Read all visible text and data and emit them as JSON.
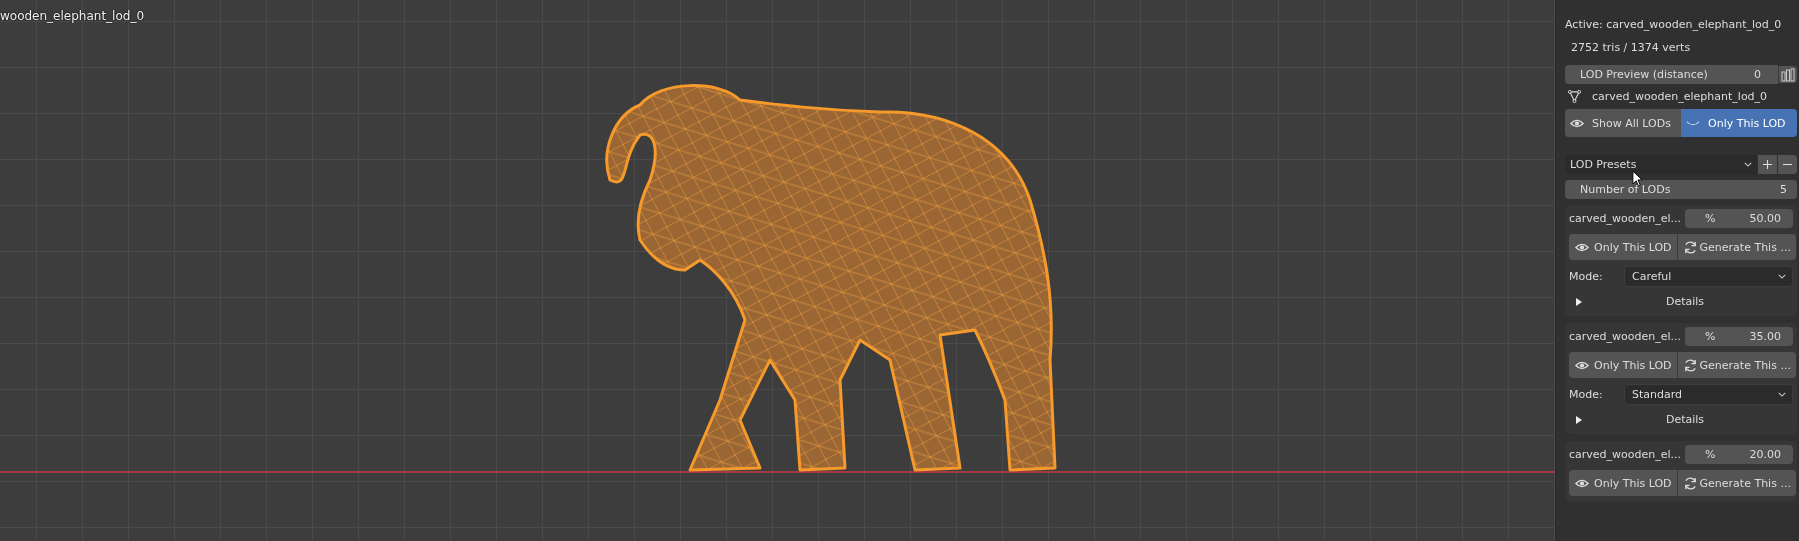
{
  "viewport": {
    "object_label": "wooden_elephant_lod_0"
  },
  "panel": {
    "active": "Active: carved_wooden_elephant_lod_0",
    "stats": "2752 tris / 1374 verts",
    "lod_preview": {
      "label": "LOD Preview (distance)",
      "value": "0"
    },
    "mesh_name": "carved_wooden_elephant_lod_0",
    "view_toggle": [
      {
        "label": "Show All LODs",
        "selected": false,
        "kind": "eye"
      },
      {
        "label": "Only This LOD",
        "selected": true,
        "kind": "closed-eye"
      }
    ],
    "presets": {
      "label": "LOD Presets"
    },
    "number_of_lods": {
      "label": "Number of LODs",
      "value": "5"
    },
    "lods": [
      {
        "name": "carved_wooden_el...",
        "unit": "%",
        "ratio": "50.00",
        "only_button": "Only This LOD",
        "generate_button": "Generate This ...",
        "mode_label": "Mode:",
        "mode": "Careful",
        "details": "Details",
        "expanded": false
      },
      {
        "name": "carved_wooden_el...",
        "unit": "%",
        "ratio": "35.00",
        "only_button": "Only This LOD",
        "generate_button": "Generate This ...",
        "mode_label": "Mode:",
        "mode": "Standard",
        "details": "Details",
        "expanded": false
      },
      {
        "name": "carved_wooden_el...",
        "unit": "%",
        "ratio": "20.00",
        "only_button": "Only This LOD",
        "generate_button": "Generate This ..."
      }
    ]
  }
}
